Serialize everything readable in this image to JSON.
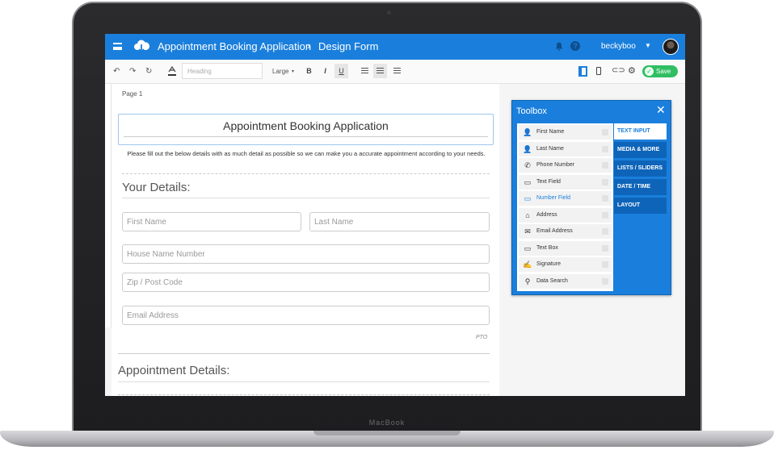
{
  "app": {
    "title": "Appointment Booking Application",
    "breadcrumb_separator": "›",
    "page_name": "Design Form",
    "username": "beckyboo",
    "help_glyph": "?",
    "device_label": "MacBook"
  },
  "toolbar": {
    "undo": "↶",
    "redo": "↷",
    "refresh": "↻",
    "heading_placeholder": "Heading",
    "size": "Large",
    "size_caret": "▾",
    "bold": "B",
    "italic": "I",
    "underline": "U",
    "save_label": "Save",
    "save_check": "✓"
  },
  "form": {
    "page_label": "Page 1",
    "title": "Appointment Booking Application",
    "intro": "Please fill out the below details with as much detail as possible so we can make you a accurate appointment according to your needs.",
    "section1": "Your Details:",
    "section2": "Appointment Details:",
    "pto": "PTO",
    "fields": {
      "first_name": "First Name",
      "last_name": "Last Name",
      "house": "House Name Number",
      "zip": "Zip / Post Code",
      "email": "Email Address"
    }
  },
  "toolbox": {
    "title": "Toolbox",
    "close": "✕",
    "items": [
      {
        "label": "First Name",
        "icon": "person-icon",
        "glyph": "👤"
      },
      {
        "label": "Last Name",
        "icon": "person-icon",
        "glyph": "👤"
      },
      {
        "label": "Phone Number",
        "icon": "phone-icon",
        "glyph": "✆"
      },
      {
        "label": "Text Field",
        "icon": "textfield-icon",
        "glyph": "▭"
      },
      {
        "label": "Number Field",
        "icon": "numberfield-icon",
        "glyph": "▭"
      },
      {
        "label": "Address",
        "icon": "home-icon",
        "glyph": "⌂"
      },
      {
        "label": "Email Address",
        "icon": "mail-icon",
        "glyph": "✉"
      },
      {
        "label": "Text Box",
        "icon": "textbox-icon",
        "glyph": "▭"
      },
      {
        "label": "Signature",
        "icon": "signature-icon",
        "glyph": "✍"
      },
      {
        "label": "Data Search",
        "icon": "search-icon",
        "glyph": "⚲"
      }
    ],
    "active_item": 4,
    "tabs": [
      "TEXT INPUT",
      "MEDIA & MORE",
      "LISTS / SLIDERS",
      "DATE / TIME",
      "LAYOUT"
    ],
    "active_tab": 0
  },
  "colors": {
    "brand": "#1a7fdc",
    "save": "#2fbf62",
    "tab_dark": "#0d64b9"
  }
}
